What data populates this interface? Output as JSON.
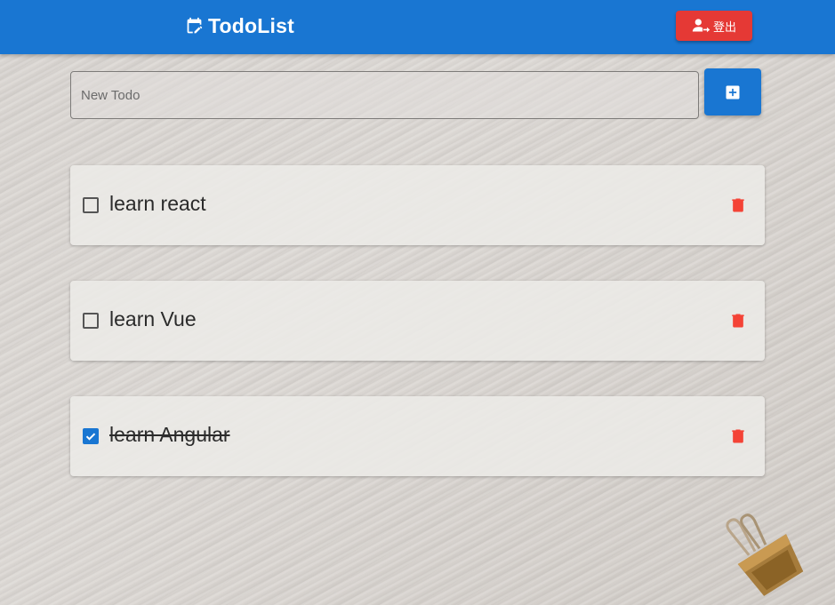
{
  "appbar": {
    "title": "TodoList",
    "brand_icon": "calendar-edit-icon",
    "logout_label": "登出",
    "logout_icon": "account-arrow-right-icon",
    "colors": {
      "primary": "#1976d2",
      "danger": "#e53935"
    }
  },
  "new_todo": {
    "placeholder": "New Todo",
    "value": "",
    "add_icon": "plus-box-icon"
  },
  "todos": [
    {
      "text": "learn react",
      "done": false
    },
    {
      "text": "learn Vue",
      "done": false
    },
    {
      "text": "learn Angular",
      "done": true
    }
  ],
  "icons": {
    "checkbox_unchecked": "checkbox-blank-outline-icon",
    "checkbox_checked": "checkbox-marked-icon",
    "delete": "trash-can-icon",
    "decor": "binder-clip-icon"
  }
}
